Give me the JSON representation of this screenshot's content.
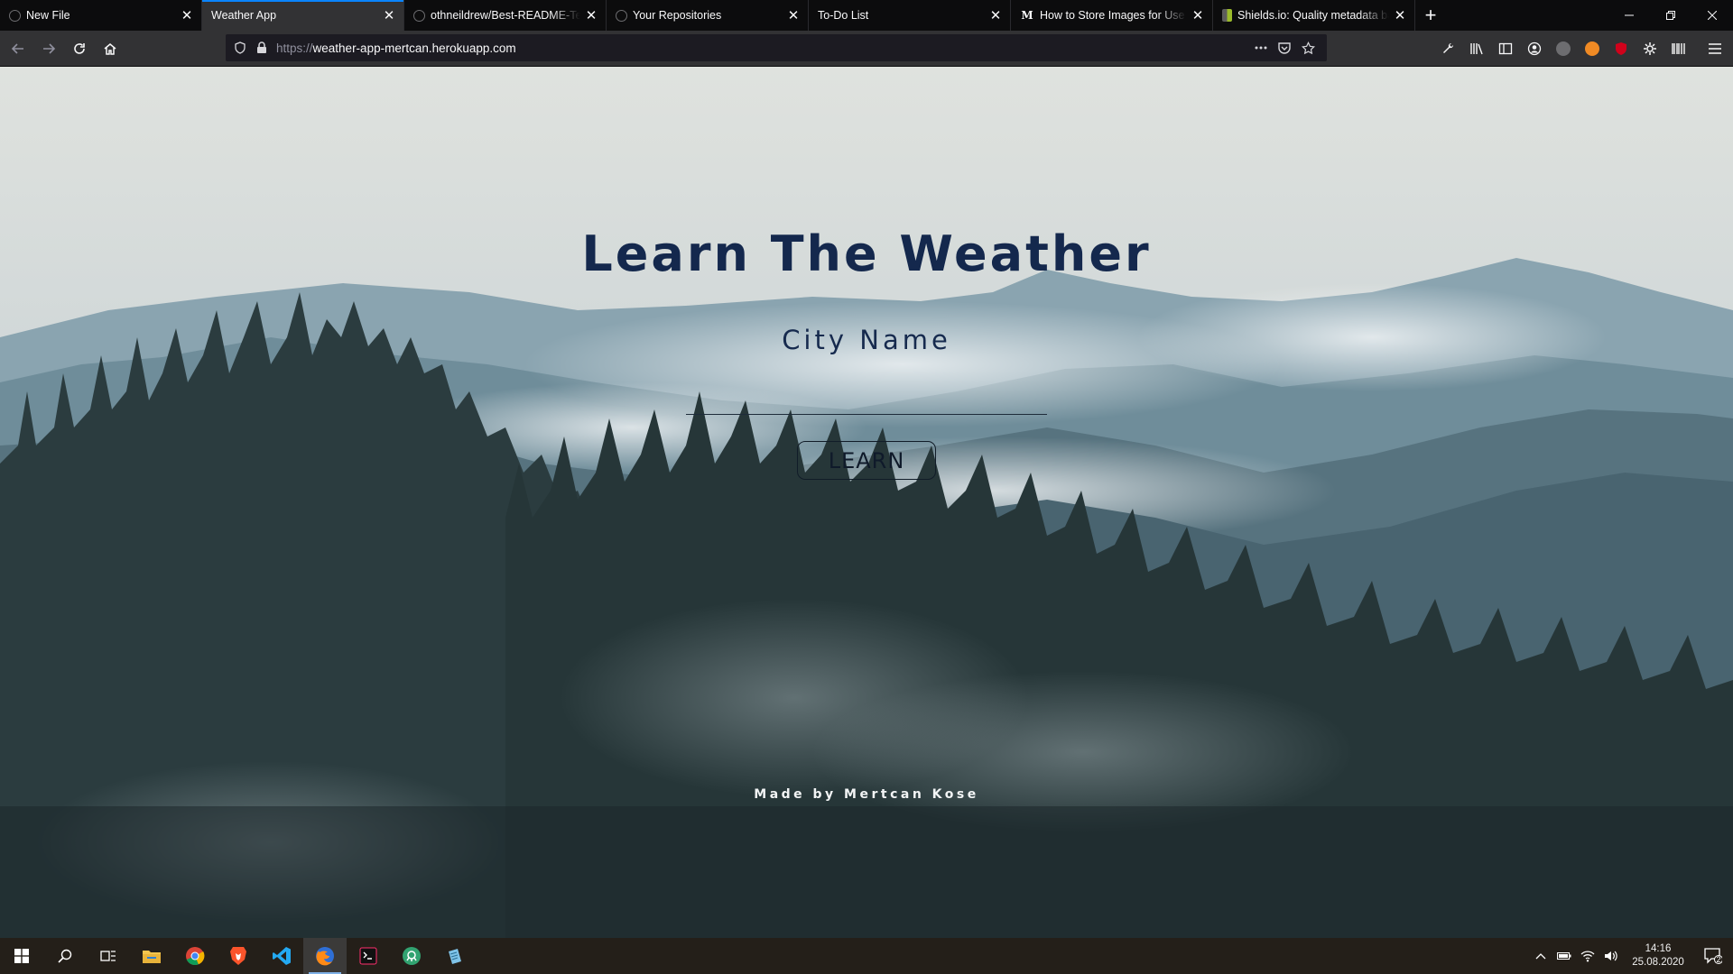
{
  "browser": {
    "tabs": [
      {
        "title": "New File",
        "favicon": "github-icon",
        "active": false
      },
      {
        "title": "Weather App",
        "favicon": "none",
        "active": true
      },
      {
        "title": "othneildrew/Best-README-Template",
        "favicon": "github-icon",
        "active": false
      },
      {
        "title": "Your Repositories",
        "favicon": "github-icon",
        "active": false
      },
      {
        "title": "To-Do List",
        "favicon": "none",
        "active": false
      },
      {
        "title": "How to Store Images for Use in",
        "favicon": "medium-icon",
        "active": false
      },
      {
        "title": "Shields.io: Quality metadata badges",
        "favicon": "shields-icon",
        "active": false
      }
    ],
    "url_scheme": "https://",
    "url_host": "weather-app-mertcan.herokuapp.com"
  },
  "app": {
    "headline": "Learn The Weather",
    "city_label": "City Name",
    "city_value": "",
    "submit_label": "LEARN",
    "footer": "Made by Mertcan Kose"
  },
  "taskbar": {
    "apps": [
      "windows-start-icon",
      "search-icon",
      "task-view-icon",
      "file-explorer-icon",
      "chrome-icon",
      "brave-icon",
      "vscode-icon",
      "firefox-icon",
      "terminal-icon",
      "gitkraken-icon",
      "notepad-icon"
    ],
    "time": "14:16",
    "date": "25.08.2020",
    "notification_count": "2"
  },
  "colors": {
    "headline": "#14284d",
    "accent_tab": "#0a84ff",
    "taskbar": "#241f19"
  }
}
